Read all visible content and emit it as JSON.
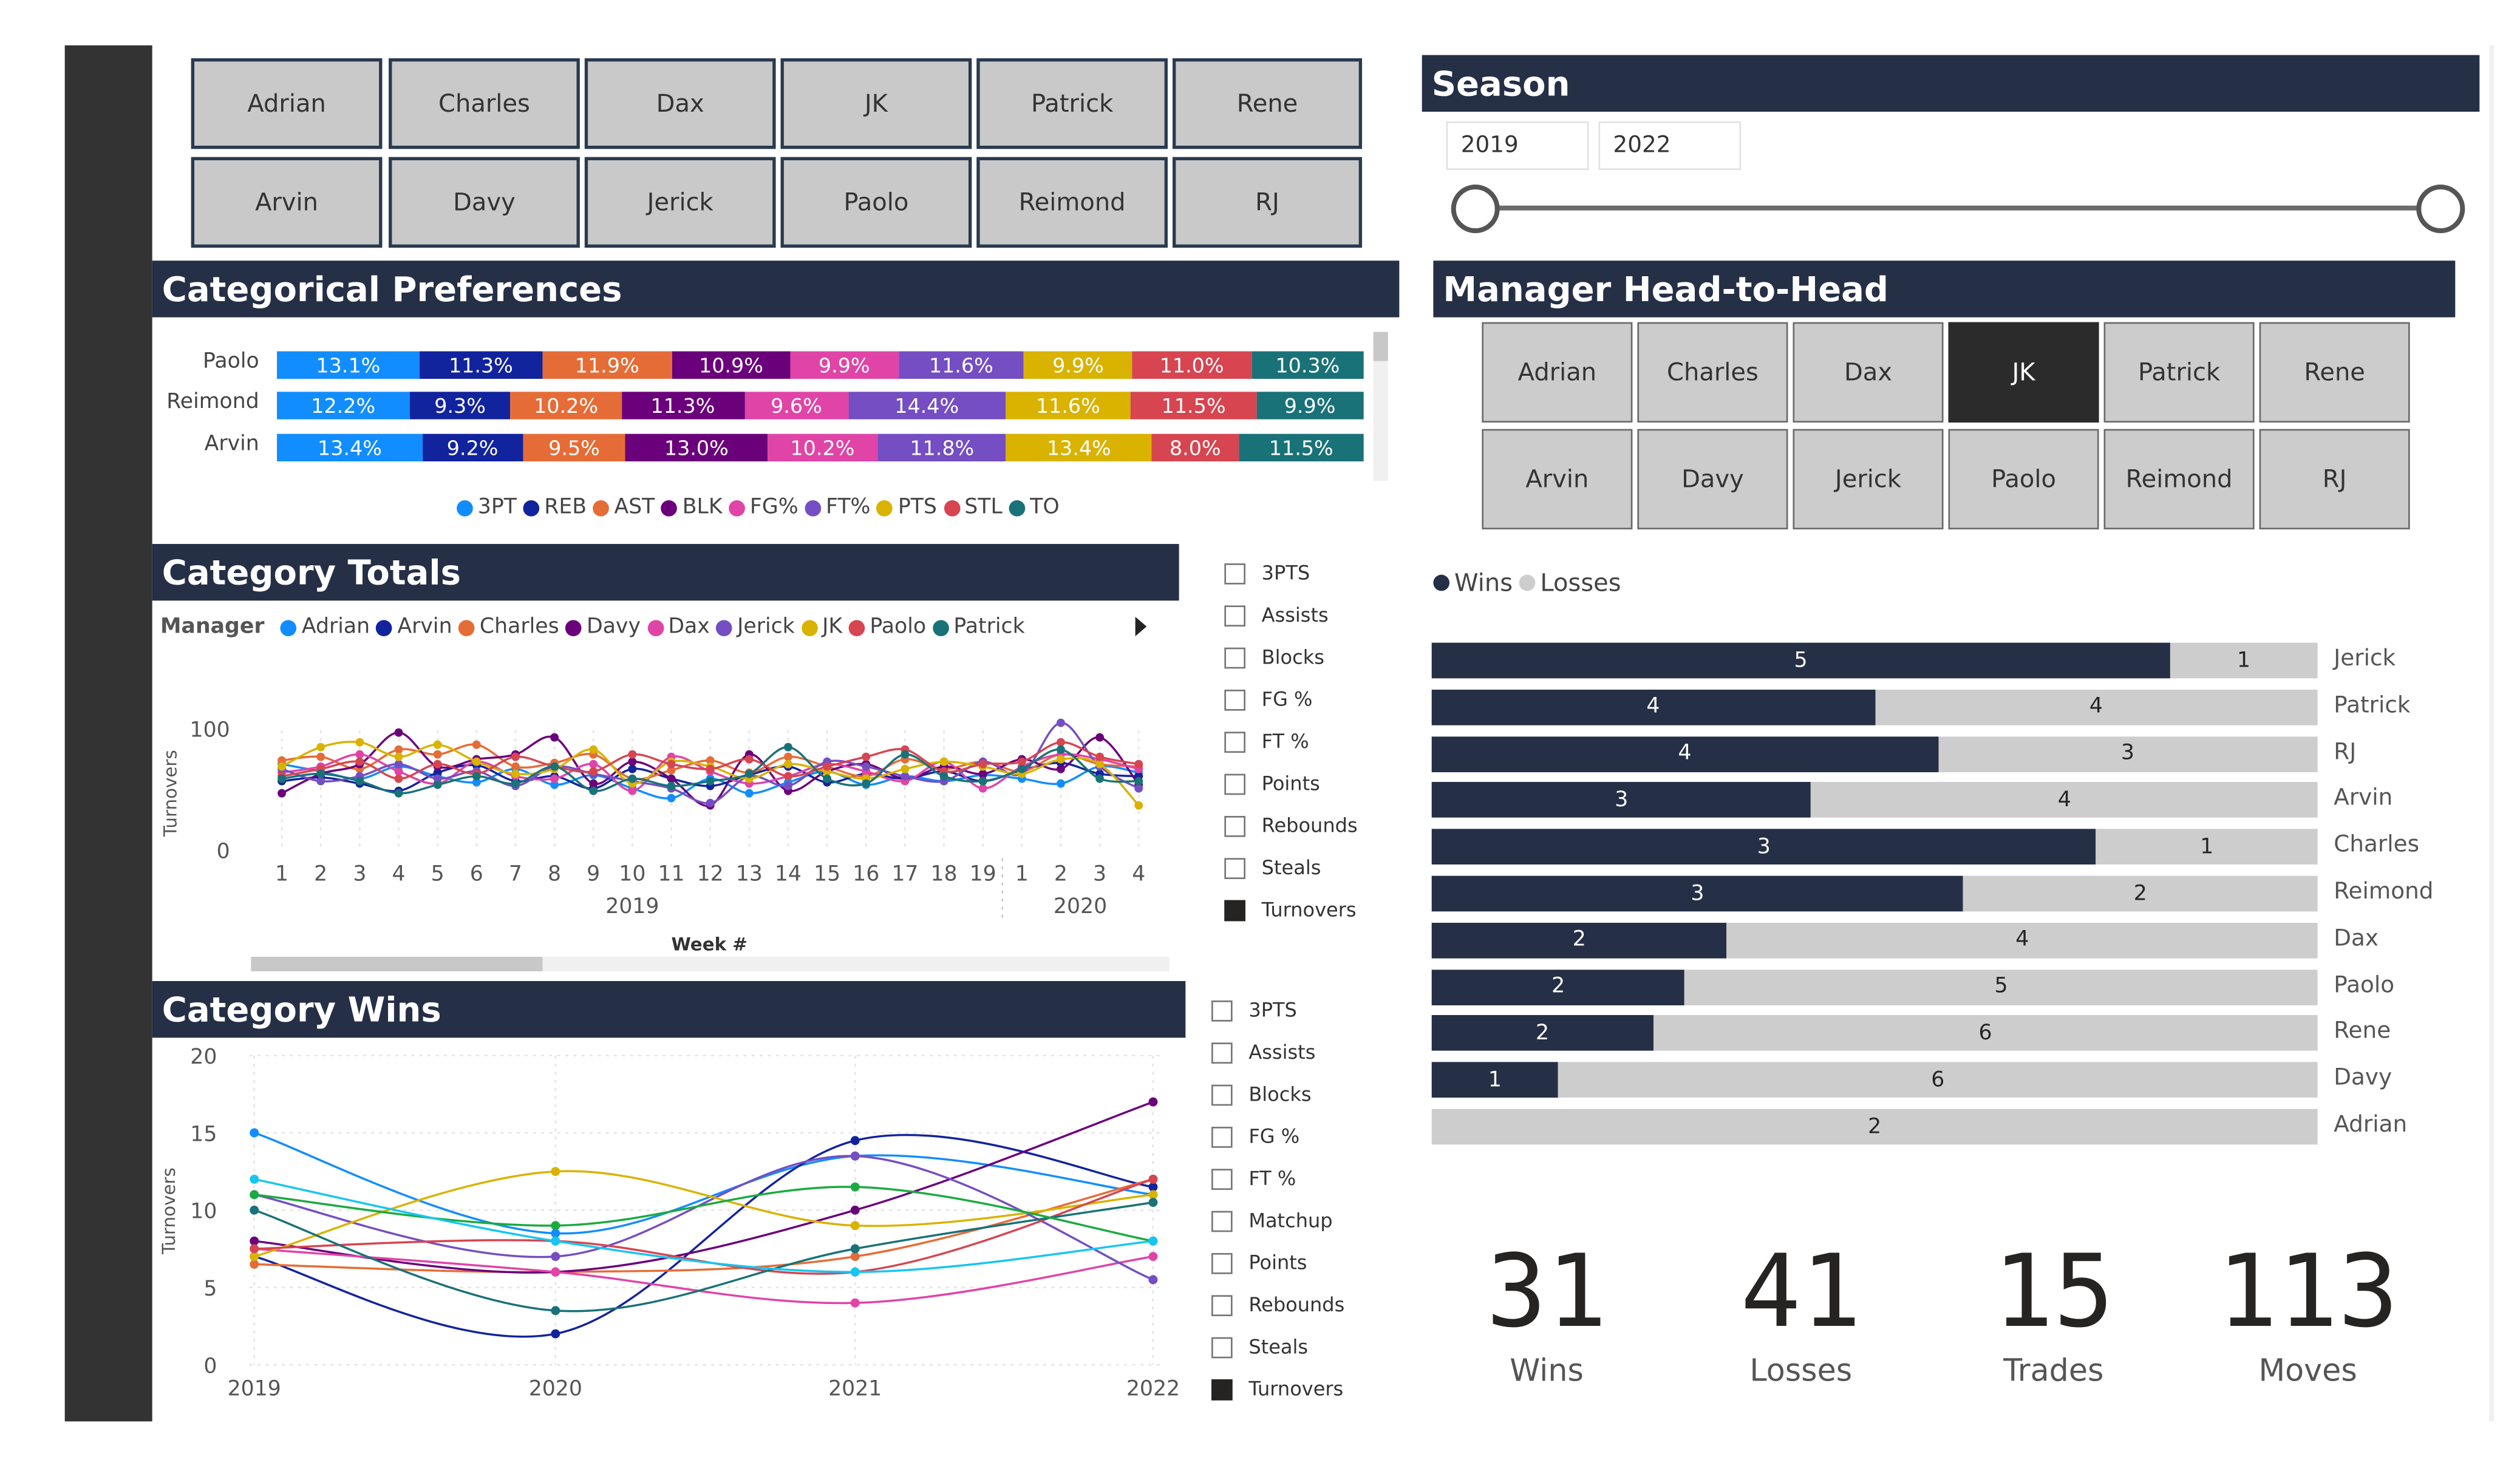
{
  "colors": {
    "header": "#252f46",
    "selected": "#2b2b2b",
    "sidebar": "#333333"
  },
  "top_slicer": {
    "row1": [
      "Adrian",
      "Charles",
      "Dax",
      "JK",
      "Patrick",
      "Rene"
    ],
    "row2": [
      "Arvin",
      "Davy",
      "Jerick",
      "Paolo",
      "Reimond",
      "RJ"
    ]
  },
  "season": {
    "title": "Season",
    "start": "2019",
    "end": "2022"
  },
  "categorical_preferences": {
    "title": "Categorical Preferences",
    "colors": [
      "#118DFF",
      "#12239E",
      "#E66C37",
      "#6B007B",
      "#E044A7",
      "#744EC2",
      "#D9B300",
      "#D64550",
      "#197278"
    ],
    "legend": [
      "3PT",
      "REB",
      "AST",
      "BLK",
      "FG%",
      "FT%",
      "PTS",
      "STL",
      "TO"
    ],
    "rows": [
      {
        "name": "Paolo",
        "values": [
          13.1,
          11.3,
          11.9,
          10.9,
          9.9,
          11.6,
          9.9,
          11.0,
          10.3
        ],
        "labels": [
          "13.1%",
          "11.3%",
          "11.9%",
          "10.9%",
          "9.9%",
          "11.6%",
          "9.9%",
          "11.0%",
          "10.3%"
        ]
      },
      {
        "name": "Reimond",
        "values": [
          12.2,
          9.3,
          10.2,
          11.3,
          9.6,
          14.4,
          11.6,
          11.5,
          9.9
        ],
        "labels": [
          "12.2%",
          "9.3%",
          "10.2%",
          "11.3%",
          "9.6%",
          "14.4%",
          "11.6%",
          "11.5%",
          "9.9%"
        ]
      },
      {
        "name": "Arvin",
        "values": [
          13.4,
          9.2,
          9.5,
          13.0,
          10.2,
          11.8,
          13.4,
          8.0,
          11.5
        ],
        "labels": [
          "13.4%",
          "9.2%",
          "9.5%",
          "13.0%",
          "10.2%",
          "11.8%",
          "13.4%",
          "8.0%",
          "11.5%"
        ]
      }
    ]
  },
  "category_totals": {
    "title": "Category Totals",
    "legend_title": "Manager",
    "managers": [
      {
        "name": "Adrian",
        "color": "#118DFF"
      },
      {
        "name": "Arvin",
        "color": "#12239E"
      },
      {
        "name": "Charles",
        "color": "#E66C37"
      },
      {
        "name": "Davy",
        "color": "#6B007B"
      },
      {
        "name": "Dax",
        "color": "#E044A7"
      },
      {
        "name": "Jerick",
        "color": "#744EC2"
      },
      {
        "name": "JK",
        "color": "#D9B300"
      },
      {
        "name": "Paolo",
        "color": "#D64550"
      },
      {
        "name": "Patrick",
        "color": "#197278"
      }
    ],
    "ylabel": "Turnovers",
    "xlabel": "Week #",
    "year_labels": [
      "2019",
      "2020"
    ],
    "filters": [
      {
        "label": "3PTS",
        "checked": false
      },
      {
        "label": "Assists",
        "checked": false
      },
      {
        "label": "Blocks",
        "checked": false
      },
      {
        "label": "FG %",
        "checked": false
      },
      {
        "label": "FT %",
        "checked": false
      },
      {
        "label": "Points",
        "checked": false
      },
      {
        "label": "Rebounds",
        "checked": false
      },
      {
        "label": "Steals",
        "checked": false
      },
      {
        "label": "Turnovers",
        "checked": true
      }
    ]
  },
  "category_wins": {
    "title": "Category Wins",
    "filters": [
      {
        "label": "3PTS",
        "checked": false
      },
      {
        "label": "Assists",
        "checked": false
      },
      {
        "label": "Blocks",
        "checked": false
      },
      {
        "label": "FG %",
        "checked": false
      },
      {
        "label": "FT %",
        "checked": false
      },
      {
        "label": "Matchup",
        "checked": false
      },
      {
        "label": "Points",
        "checked": false
      },
      {
        "label": "Rebounds",
        "checked": false
      },
      {
        "label": "Steals",
        "checked": false
      },
      {
        "label": "Turnovers",
        "checked": true
      }
    ]
  },
  "head_to_head": {
    "title": "Manager Head-to-Head",
    "row1": [
      "Adrian",
      "Charles",
      "Dax",
      "JK",
      "Patrick",
      "Rene"
    ],
    "row2": [
      "Arvin",
      "Davy",
      "Jerick",
      "Paolo",
      "Reimond",
      "RJ"
    ],
    "selected": "JK"
  },
  "kpis": [
    {
      "value": "31",
      "label": "Wins"
    },
    {
      "value": "41",
      "label": "Losses"
    },
    {
      "value": "15",
      "label": "Trades"
    },
    {
      "value": "113",
      "label": "Moves"
    }
  ],
  "chart_data": [
    {
      "type": "bar",
      "orientation": "horizontal-stacked-100",
      "title": "Categorical Preferences",
      "categories": [
        "Paolo",
        "Reimond",
        "Arvin"
      ],
      "series": [
        {
          "name": "3PT",
          "values": [
            13.1,
            12.2,
            13.4
          ]
        },
        {
          "name": "REB",
          "values": [
            11.3,
            9.3,
            9.2
          ]
        },
        {
          "name": "AST",
          "values": [
            11.9,
            10.2,
            9.5
          ]
        },
        {
          "name": "BLK",
          "values": [
            10.9,
            11.3,
            13.0
          ]
        },
        {
          "name": "FG%",
          "values": [
            9.9,
            9.6,
            10.2
          ]
        },
        {
          "name": "FT%",
          "values": [
            11.6,
            14.4,
            11.8
          ]
        },
        {
          "name": "PTS",
          "values": [
            9.9,
            11.6,
            13.4
          ]
        },
        {
          "name": "STL",
          "values": [
            11.0,
            11.5,
            8.0
          ]
        },
        {
          "name": "TO",
          "values": [
            10.3,
            9.9,
            11.5
          ]
        }
      ]
    },
    {
      "type": "line",
      "title": "Category Totals",
      "xlabel": "Week #",
      "ylabel": "Turnovers",
      "x": [
        "1",
        "2",
        "3",
        "4",
        "5",
        "6",
        "7",
        "8",
        "9",
        "10",
        "11",
        "12",
        "13",
        "14",
        "15",
        "16",
        "17",
        "18",
        "19",
        "1",
        "2",
        "3",
        "4"
      ],
      "ylim": [
        0,
        100
      ],
      "yticks": [
        0,
        100
      ],
      "series": [
        {
          "name": "Adrian",
          "values": [
            72,
            66,
            60,
            70,
            62,
            57,
            68,
            55,
            63,
            52,
            44,
            60,
            48,
            57,
            66,
            55,
            62,
            58,
            63,
            60,
            56,
            70,
            65
          ]
        },
        {
          "name": "Arvin",
          "values": [
            58,
            61,
            56,
            50,
            65,
            71,
            58,
            62,
            52,
            68,
            60,
            54,
            63,
            70,
            57,
            64,
            60,
            66,
            58,
            67,
            73,
            64,
            62
          ]
        },
        {
          "name": "Charles",
          "values": [
            75,
            78,
            68,
            84,
            80,
            88,
            70,
            73,
            80,
            60,
            67,
            75,
            65,
            78,
            70,
            62,
            76,
            68,
            74,
            66,
            80,
            72,
            70
          ]
        },
        {
          "name": "Davy",
          "values": [
            48,
            64,
            72,
            98,
            70,
            76,
            80,
            94,
            56,
            74,
            60,
            38,
            80,
            50,
            66,
            72,
            60,
            70,
            64,
            76,
            68,
            94,
            55
          ]
        },
        {
          "name": "Dax",
          "values": [
            65,
            70,
            80,
            66,
            56,
            74,
            62,
            60,
            72,
            50,
            78,
            66,
            56,
            62,
            72,
            66,
            58,
            74,
            52,
            70,
            80,
            76,
            68
          ]
        },
        {
          "name": "Jerick",
          "values": [
            68,
            58,
            62,
            72,
            60,
            66,
            54,
            70,
            64,
            58,
            52,
            40,
            62,
            54,
            74,
            70,
            62,
            58,
            74,
            64,
            106,
            70,
            52
          ]
        },
        {
          "name": "JK",
          "values": [
            70,
            86,
            90,
            78,
            88,
            74,
            64,
            68,
            84,
            56,
            74,
            70,
            60,
            72,
            66,
            60,
            68,
            74,
            70,
            64,
            76,
            72,
            38
          ]
        },
        {
          "name": "Paolo",
          "values": [
            62,
            68,
            74,
            60,
            72,
            64,
            78,
            70,
            66,
            80,
            72,
            68,
            76,
            62,
            70,
            78,
            84,
            66,
            72,
            74,
            90,
            78,
            72
          ]
        },
        {
          "name": "Patrick",
          "values": [
            60,
            64,
            58,
            48,
            55,
            62,
            56,
            70,
            50,
            60,
            54,
            58,
            64,
            86,
            60,
            56,
            80,
            62,
            58,
            68,
            84,
            60,
            58
          ]
        }
      ]
    },
    {
      "type": "line",
      "title": "Category Wins",
      "ylabel": "Turnovers",
      "x": [
        "2019",
        "2020",
        "2021",
        "2022"
      ],
      "ylim": [
        0,
        20
      ],
      "yticks": [
        0,
        5,
        10,
        15,
        20
      ],
      "series": [
        {
          "values": [
            15,
            8.5,
            13.5,
            11
          ]
        },
        {
          "values": [
            7,
            2,
            14.5,
            11.5
          ]
        },
        {
          "values": [
            6.5,
            6,
            7,
            12
          ]
        },
        {
          "values": [
            8,
            6,
            10,
            17
          ]
        },
        {
          "values": [
            7.5,
            6,
            4,
            7
          ]
        },
        {
          "values": [
            11,
            7,
            13.5,
            5.5
          ]
        },
        {
          "values": [
            7,
            12.5,
            9,
            11
          ]
        },
        {
          "values": [
            7.5,
            8,
            6,
            12
          ]
        },
        {
          "values": [
            10,
            3.5,
            7.5,
            10.5
          ]
        },
        {
          "values": [
            11,
            9,
            11.5,
            8
          ]
        },
        {
          "values": [
            12,
            8,
            6,
            8
          ]
        }
      ]
    },
    {
      "type": "bar",
      "orientation": "horizontal-stacked",
      "title": "Manager Head-to-Head",
      "categories": [
        "Jerick",
        "Patrick",
        "RJ",
        "Arvin",
        "Charles",
        "Reimond",
        "Dax",
        "Paolo",
        "Rene",
        "Davy",
        "Adrian"
      ],
      "series": [
        {
          "name": "Wins",
          "values": [
            5,
            4,
            4,
            3,
            3,
            3,
            2,
            2,
            2,
            1,
            0
          ]
        },
        {
          "name": "Losses",
          "values": [
            1,
            4,
            3,
            4,
            1,
            2,
            4,
            5,
            6,
            6,
            2
          ]
        }
      ]
    }
  ],
  "h2h_legend": [
    "Wins",
    "Losses"
  ],
  "h2h_win_labels": [
    "5",
    "4",
    "4",
    "3",
    "3",
    "3",
    "2",
    "2",
    "2",
    "1",
    ""
  ],
  "h2h_loss_labels": [
    "1",
    "4",
    "3",
    "4",
    "1",
    "2",
    "4",
    "5",
    "6",
    "6",
    "2"
  ]
}
